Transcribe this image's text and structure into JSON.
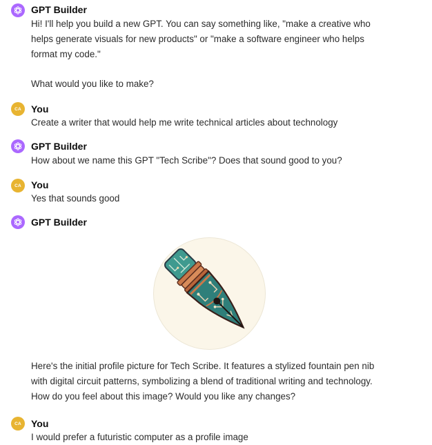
{
  "conversation": {
    "messages": [
      {
        "author": "GPT Builder",
        "role": "assistant",
        "paragraphs": [
          "Hi! I'll help you build a new GPT. You can say something like, \"make a creative who helps generate visuals for new products\" or \"make a software engineer who helps format my code.\"",
          "What would you like to make?"
        ]
      },
      {
        "author": "You",
        "role": "user",
        "avatar_initials": "CA",
        "paragraphs": [
          "Create a writer that would help me write technical articles about technology"
        ]
      },
      {
        "author": "GPT Builder",
        "role": "assistant",
        "paragraphs": [
          "How about we name this GPT \"Tech Scribe\"? Does that sound good to you?"
        ]
      },
      {
        "author": "You",
        "role": "user",
        "avatar_initials": "CA",
        "paragraphs": [
          "Yes that sounds good"
        ]
      },
      {
        "author": "GPT Builder",
        "role": "assistant",
        "image": {
          "icon": "fountain-pen-nib-circuit-icon"
        },
        "paragraphs": [
          "Here's the initial profile picture for Tech Scribe. It features a stylized fountain pen nib with digital circuit patterns, symbolizing a blend of traditional writing and technology. How do you feel about this image? Would you like any changes?"
        ]
      },
      {
        "author": "You",
        "role": "user",
        "avatar_initials": "CA",
        "paragraphs": [
          "I would prefer a futuristic computer as a profile image"
        ]
      }
    ]
  },
  "colors": {
    "assistant_avatar": "#ab68ff",
    "user_avatar": "#e8b431",
    "text": "#2b2b2b",
    "author": "#0d0d0d"
  }
}
